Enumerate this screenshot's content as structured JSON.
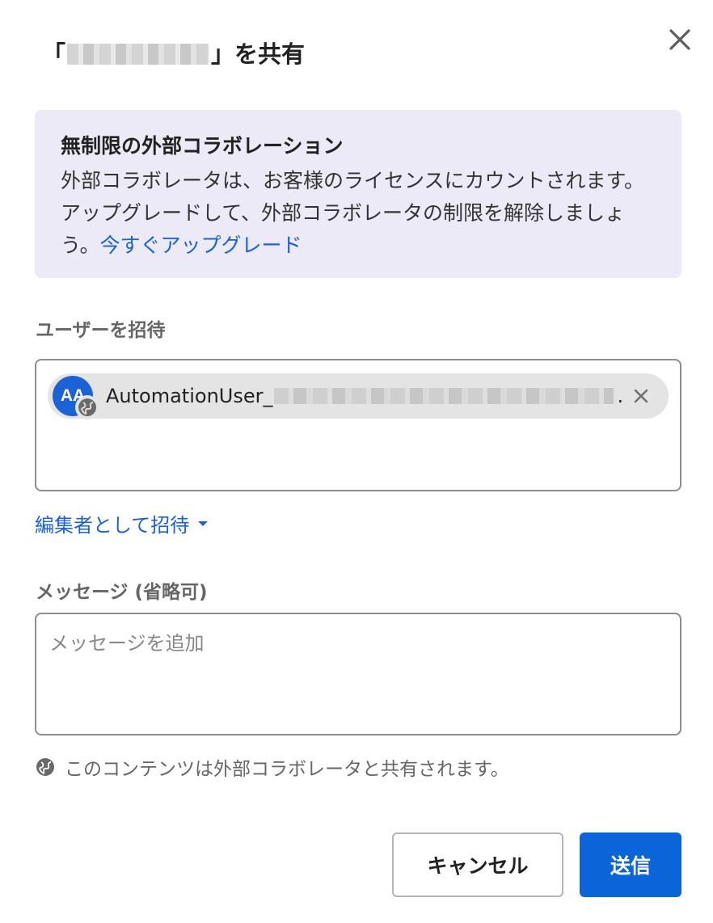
{
  "dialog": {
    "title_prefix": "「",
    "title_suffix": "」を共有",
    "close_icon": "close-icon"
  },
  "banner": {
    "title": "無制限の外部コラボレーション",
    "body": "外部コラボレータは、お客様のライセンスにカウントされます。アップグレードして、外部コラボレータの制限を解除しましょう。",
    "link": "今すぐアップグレード"
  },
  "invite": {
    "label": "ユーザーを招待",
    "chips": [
      {
        "initials": "AA",
        "name_visible": "AutomationUser_",
        "ellipsis": ".",
        "badge_icon": "globe-icon",
        "remove_icon": "close-icon"
      }
    ],
    "role_label": "編集者として招待",
    "role_icon": "caret-down-icon"
  },
  "message": {
    "label": "メッセージ (省略可)",
    "placeholder": "メッセージを追加",
    "value": ""
  },
  "external_note": {
    "icon": "globe-icon",
    "text": "このコンテンツは外部コラボレータと共有されます。"
  },
  "buttons": {
    "cancel": "キャンセル",
    "send": "送信"
  },
  "colors": {
    "accent": "#0b65d8",
    "link": "#1a62d6",
    "banner_bg": "#ebeaf6",
    "chip_bg": "#e4e4e4"
  }
}
